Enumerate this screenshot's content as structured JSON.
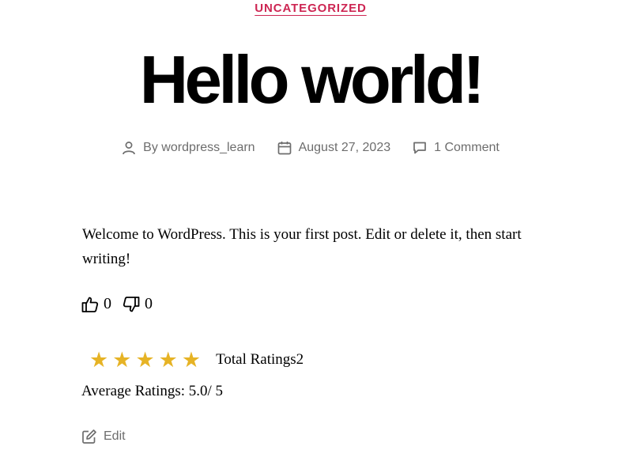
{
  "post": {
    "category": "UNCATEGORIZED",
    "title": "Hello world!",
    "meta": {
      "author": "By wordpress_learn",
      "date": "August 27, 2023",
      "comments": "1 Comment",
      "author_icon": "user-icon",
      "date_icon": "calendar-icon",
      "comments_icon": "comment-icon"
    },
    "content": "Welcome to WordPress. This is your first post. Edit or delete it, then start writing!"
  },
  "votes": {
    "likes": "0",
    "dislikes": "0",
    "like_icon": "thumbs-up-icon",
    "dislike_icon": "thumbs-down-icon"
  },
  "ratings": {
    "stars_filled": 5,
    "stars_total": 5,
    "total_label": "Total Ratings2",
    "average_label": "Average Ratings: 5.0/ 5"
  },
  "edit": {
    "label": "Edit",
    "icon": "edit-icon"
  },
  "colors": {
    "accent": "#cd2653",
    "meta": "#6d6d6d",
    "star": "#e6b325"
  }
}
